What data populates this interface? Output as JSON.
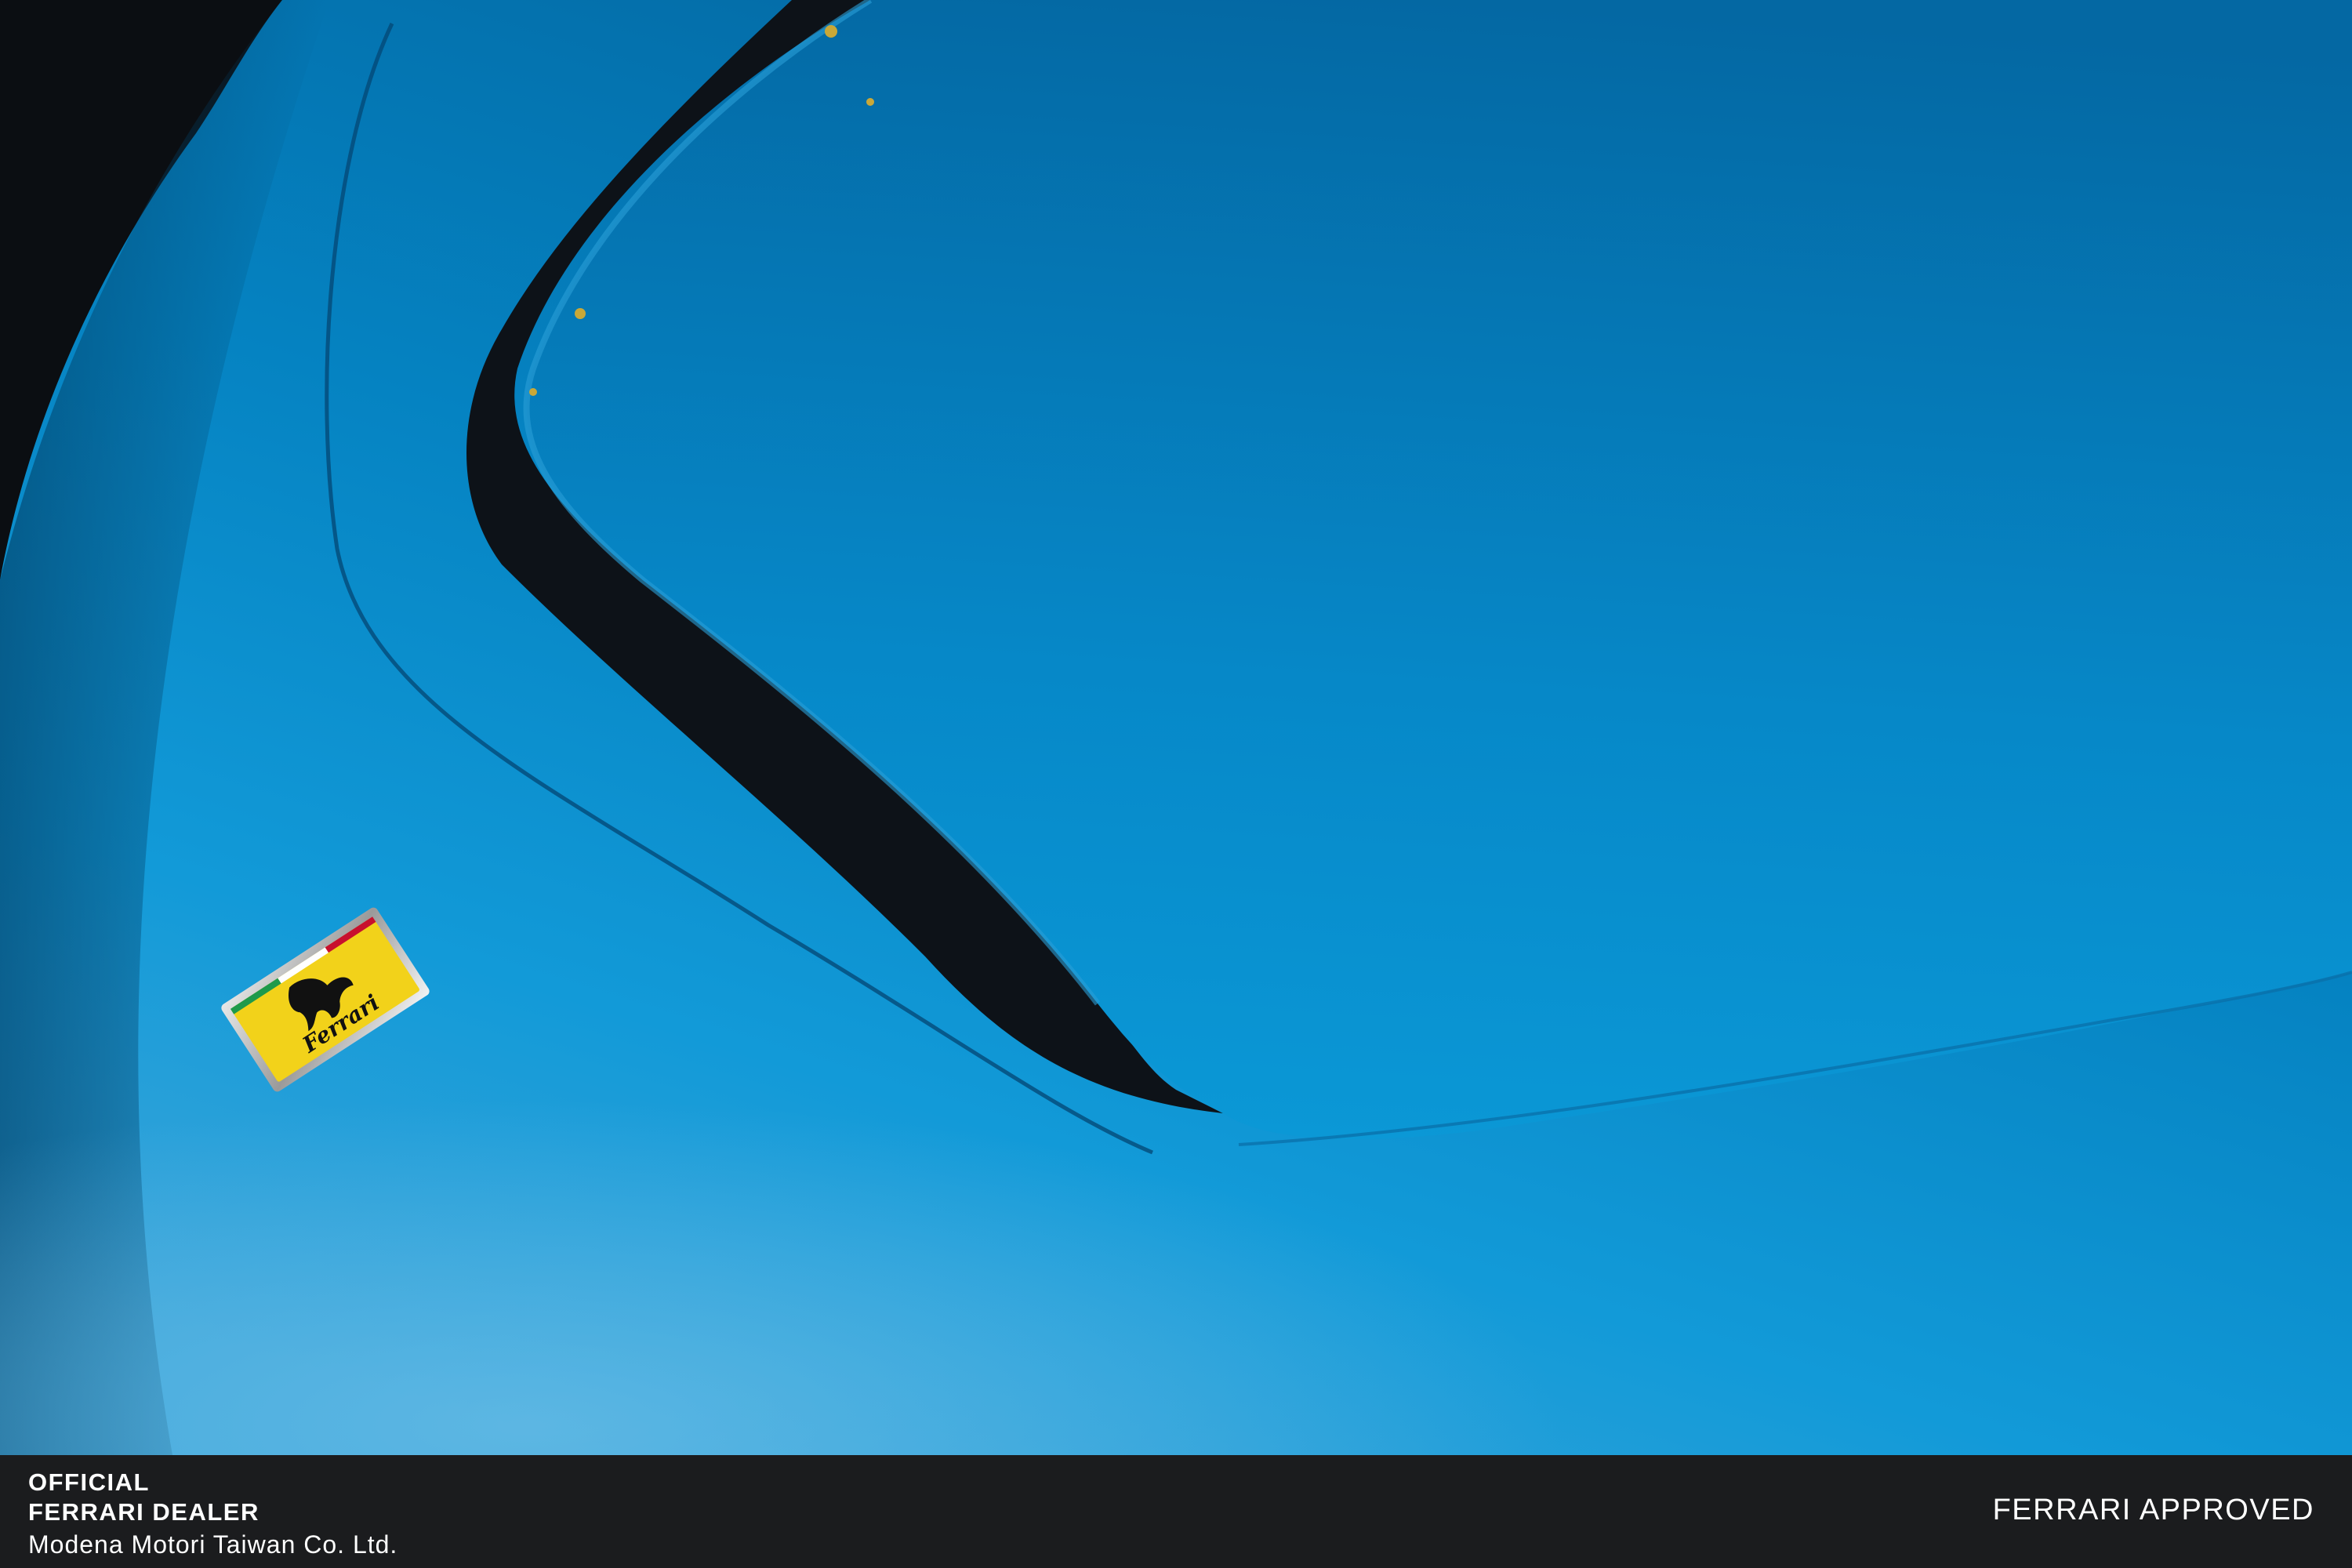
{
  "photo": {
    "subject": "ferrari-hood-closeup",
    "colors": {
      "paint_dark": "#03629b",
      "paint_mid": "#0a8fcf",
      "paint_light": "#46a9db",
      "vent_black": "#0d1218",
      "badge_yellow": "#f2d21a",
      "badge_red": "#c8102e",
      "badge_green": "#1e9a4b"
    },
    "badge": {
      "icon": "prancing-horse-icon",
      "wordmark": "Ferrari"
    }
  },
  "footer": {
    "background": "#1b1c1e",
    "line1": "OFFICIAL",
    "line2": "FERRARI DEALER",
    "company": "Modena Motori Taiwan Co. Ltd.",
    "right_label": "FERRARI APPROVED"
  }
}
